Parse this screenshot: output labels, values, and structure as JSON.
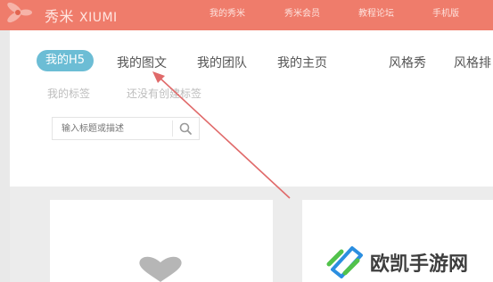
{
  "header": {
    "logo_cn": "秀米",
    "logo_en": "XIUMI",
    "nav": [
      "我的秀米",
      "秀米会员",
      "教程论坛",
      "手机版"
    ],
    "bg_color": "#ef7c6b"
  },
  "tabs": {
    "items": [
      "我的H5",
      "我的图文",
      "我的团队",
      "我的主页",
      "风格秀",
      "风格排"
    ],
    "active_index": 0,
    "active_color": "#6cbdd5"
  },
  "subtags": [
    "我的标签",
    "还没有创建标签"
  ],
  "search": {
    "placeholder": "输入标题或描述",
    "icon": "search-icon"
  },
  "annotation": {
    "color": "#e05a5a",
    "target": "tab-my-graphic"
  },
  "watermark": {
    "text": "欧凯手游网",
    "icon": "okay-logo-icon",
    "colors": [
      "#2b8ee0",
      "#52c24b"
    ]
  }
}
